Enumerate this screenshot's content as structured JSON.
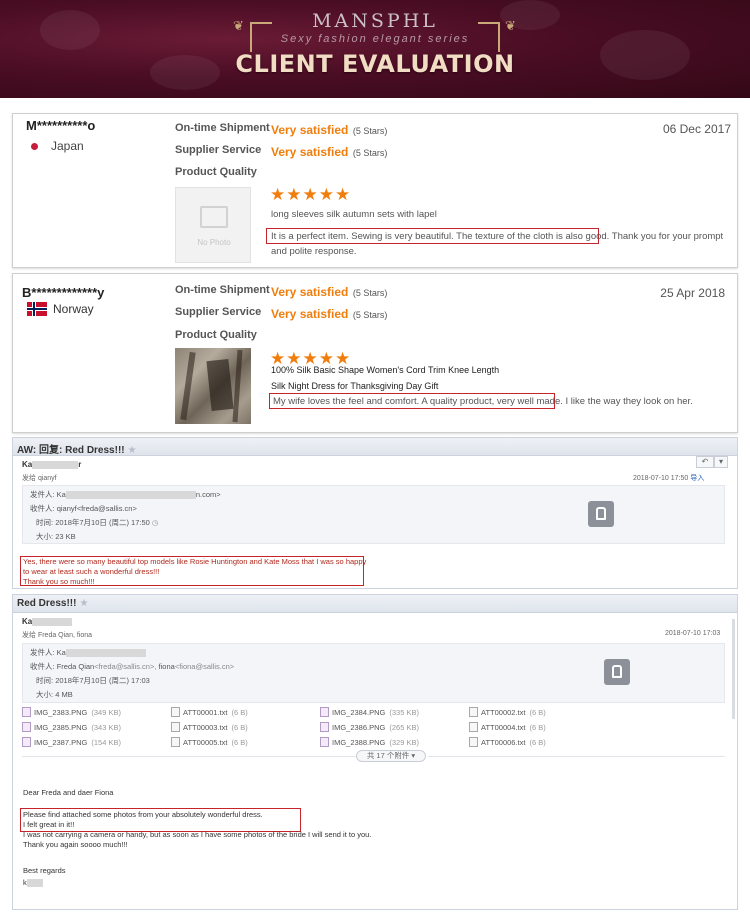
{
  "banner": {
    "brand": "MANSPHL",
    "tagline": "Sexy fashion elegant series",
    "heading": "CLIENT EVALUATION",
    "accent": "#4a0d24"
  },
  "labels": {
    "ontime": "On-time Shipment",
    "supplier": "Supplier Service",
    "quality": "Product Quality",
    "no_photo": "No Photo"
  },
  "reviews": [
    {
      "name": "M**********o",
      "country": "Japan",
      "date": "06 Dec 2017",
      "ontime_rating": "Very satisfied",
      "ontime_stars": "(5 Stars)",
      "supplier_rating": "Very satisfied",
      "supplier_stars": "(5 Stars)",
      "stars": "★★★★★",
      "title": "long sleeves silk autumn sets with lapel",
      "highlight": "It is a perfect item. Sewing is very beautiful. The texture of the cloth is also good.",
      "rest": "Thank you for your prompt and polite response."
    },
    {
      "name": "B*************y",
      "country": "Norway",
      "date": "25 Apr 2018",
      "ontime_rating": "Very satisfied",
      "ontime_stars": "(5 Stars)",
      "supplier_rating": "Very satisfied",
      "supplier_stars": "(5 Stars)",
      "stars": "★★★★★",
      "title_line1": "100% Silk Basic Shape Women's Cord Trim Knee Length",
      "title_line2": "Silk Night Dress for Thanksgiving Day Gift",
      "highlight": "My wife loves the feel and comfort. A quality product, very well made.",
      "rest": "I like the way they look on her."
    }
  ],
  "email1": {
    "subject": "AW: 回复: Red Dress!!!",
    "sender_initial": "Ka",
    "sender_tail": "r",
    "from_line": "发给 qianyf",
    "datetime": "2018-07-10 17:50",
    "tag": "导入",
    "from_label": "发件人: Ka",
    "from_tail": "n.com>",
    "to_label": "收件人:",
    "to_value": "qianyf<freda@sallis.cn>",
    "time_label": "时间:",
    "time_value": "2018年7月10日 (周二) 17:50",
    "size_label": "大小:",
    "size_value": "23 KB",
    "body_line1": "Yes, there were so many beautiful top models like Rosie Huntington and Kate Moss that I was so happy",
    "body_line2": "to wear at least such a wonderful dress!!!",
    "body_line3": "Thank you so much!!!"
  },
  "email2": {
    "subject": "Red Dress!!!",
    "sender_initial": "Ka",
    "from_line": "发给 Freda Qian, fiona",
    "datetime": "2018-07-10 17:03",
    "from_label": "发件人: Ka",
    "to_label": "收件人:",
    "to_value1": "Freda Qian",
    "to_email1": "<freda@sallis.cn>,",
    "to_value2": "fiona",
    "to_email2": "<fiona@sallis.cn>",
    "time_label": "时间:",
    "time_value": "2018年7月10日 (周二) 17:03",
    "size_label": "大小:",
    "size_value": "4 MB",
    "attachments": [
      {
        "name": "IMG_2383.PNG",
        "size": "(349 KB)",
        "kind": "img"
      },
      {
        "name": "ATT00001.txt",
        "size": "(6 B)",
        "kind": "txt"
      },
      {
        "name": "IMG_2384.PNG",
        "size": "(335 KB)",
        "kind": "img"
      },
      {
        "name": "ATT00002.txt",
        "size": "(6 B)",
        "kind": "txt"
      },
      {
        "name": "IMG_2385.PNG",
        "size": "(343 KB)",
        "kind": "img"
      },
      {
        "name": "ATT00003.txt",
        "size": "(6 B)",
        "kind": "txt"
      },
      {
        "name": "IMG_2386.PNG",
        "size": "(265 KB)",
        "kind": "img"
      },
      {
        "name": "ATT00004.txt",
        "size": "(6 B)",
        "kind": "txt"
      },
      {
        "name": "IMG_2387.PNG",
        "size": "(154 KB)",
        "kind": "img"
      },
      {
        "name": "ATT00005.txt",
        "size": "(6 B)",
        "kind": "txt"
      },
      {
        "name": "IMG_2388.PNG",
        "size": "(329 KB)",
        "kind": "img"
      },
      {
        "name": "ATT00006.txt",
        "size": "(6 B)",
        "kind": "txt"
      }
    ],
    "attach_count": "共 17 个附件 ▾",
    "greeting": "Dear Freda and daer Fiona",
    "hl_line1": "Please find attached some photos from your absolutely wonderful dress.",
    "hl_line2": "I felt great in it!!",
    "body_line3": "I was not carrying a camera or handy, but as soon as I have some photos of the bride I will send it to you.",
    "body_line4": "Thank you again soooo much!!!",
    "closing": "Best regards",
    "sign": "k"
  }
}
